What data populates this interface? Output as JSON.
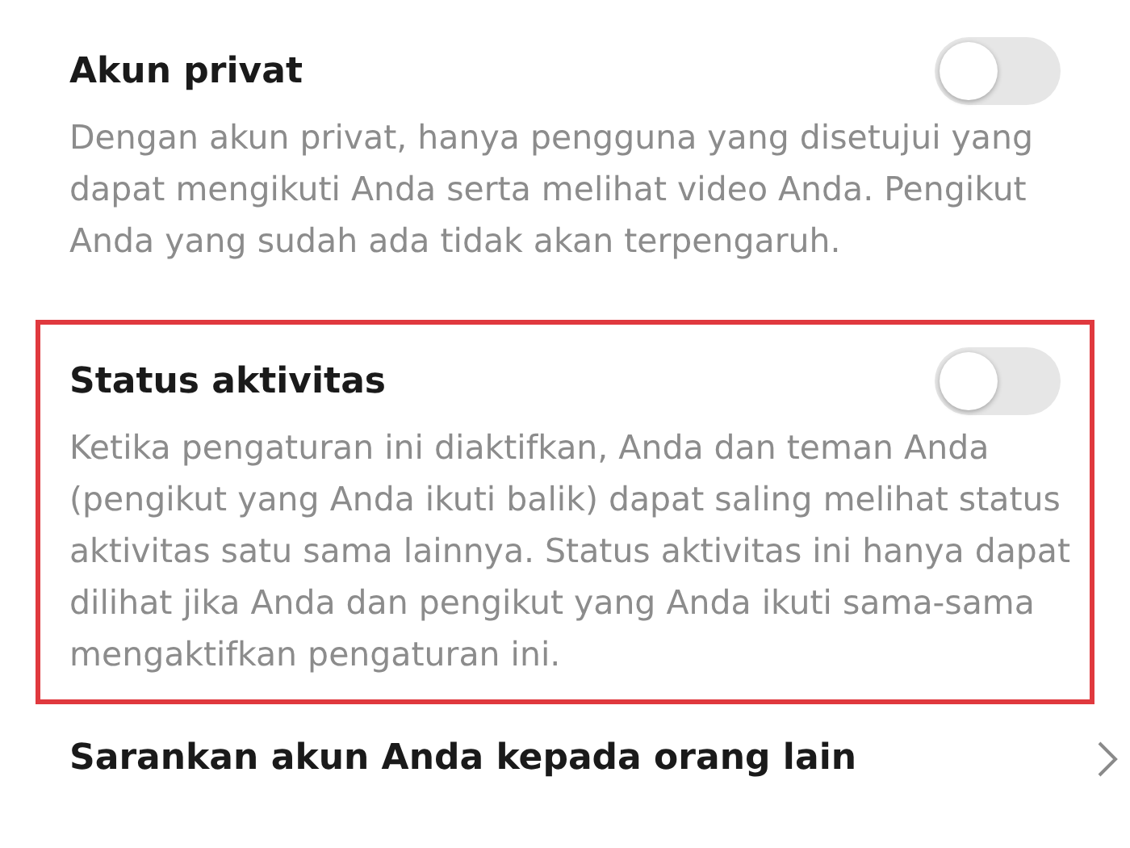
{
  "settings": [
    {
      "kind": "toggle",
      "title": "Akun privat",
      "on": false,
      "highlighted": false,
      "description": "Dengan akun privat, hanya pengguna yang disetujui yang dapat mengikuti Anda serta melihat video Anda. Pengikut Anda yang sudah ada tidak akan terpengaruh."
    },
    {
      "kind": "toggle",
      "title": "Status aktivitas",
      "on": false,
      "highlighted": true,
      "description": "Ketika pengaturan ini diaktifkan, Anda dan teman Anda (pengikut yang Anda ikuti balik) dapat saling melihat status aktivitas satu sama lainnya. Status aktivitas ini hanya dapat dilihat jika Anda dan pengikut yang Anda ikuti sama-sama mengaktifkan pengaturan ini."
    },
    {
      "kind": "link",
      "title": "Sarankan akun Anda kepada orang lain",
      "highlighted": false
    }
  ]
}
